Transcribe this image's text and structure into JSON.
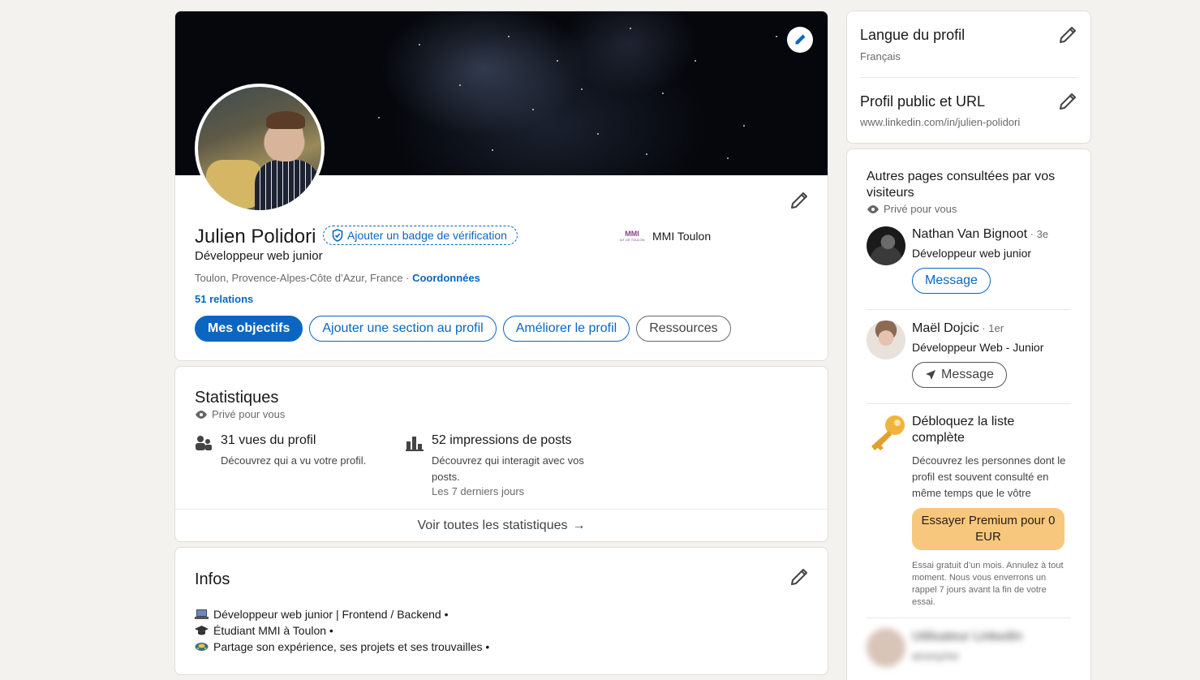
{
  "profile": {
    "name": "Julien Polidori",
    "verify_badge_label": "Ajouter un badge de vérification",
    "headline": "Développeur web junior",
    "location": "Toulon, Provence-Alpes-Côte d’Azur, France",
    "location_sep": " · ",
    "contact_link": "Coordonnées",
    "relations": "51 relations",
    "school_logo_text": "MMI",
    "school_logo_sub": "IUT DE TOULON",
    "school_name": "MMI Toulon",
    "buttons": {
      "goals": "Mes objectifs",
      "add_section": "Ajouter une section au profil",
      "improve": "Améliorer le profil",
      "resources": "Ressources"
    }
  },
  "stats": {
    "title": "Statistiques",
    "private": "Privé pour vous",
    "views_title": "31 vues du profil",
    "views_desc": "Découvrez qui a vu votre profil.",
    "impressions_title": "52 impressions de posts",
    "impressions_desc": "Découvrez qui interagit avec vos posts.",
    "impressions_period": "Les 7 derniers jours",
    "see_all": "Voir toutes les statistiques",
    "arrow": "→"
  },
  "infos": {
    "title": "Infos",
    "lines": [
      "Développeur web junior | Frontend / Backend •",
      "Étudiant MMI à Toulon •",
      "Partage son expérience, ses projets et ses trouvailles •"
    ]
  },
  "sidebar": {
    "language_title": "Langue du profil",
    "language_value": "Français",
    "public_title": "Profil public et URL",
    "public_url": "www.linkedin.com/in/julien-polidori",
    "visitors_title": "Autres pages consultées par vos visiteurs",
    "visitors_private": "Privé pour vous",
    "people": [
      {
        "name": "Nathan Van Bignoot",
        "degree": " · 3e",
        "headline": "Développeur web junior",
        "button": "Message"
      },
      {
        "name": "Maël Dojcic",
        "degree": " · 1er",
        "headline": "Développeur Web - Junior",
        "button": "Message"
      }
    ],
    "unlock_title": "Débloquez la liste complète",
    "unlock_desc": "Découvrez les personnes dont le profil est souvent consulté en même temps que le vôtre",
    "premium_button": "Essayer Premium pour 0 EUR",
    "premium_note": "Essai gratuit d’un mois. Annulez à tout moment. Nous vous enverrons un rappel 7 jours avant la fin de votre essai.",
    "blurred_name": "Utilisateur LinkedIn",
    "blurred_sub": "anonyme"
  },
  "colors": {
    "brand_blue": "#0a66c2",
    "premium_gold": "#f8c77e",
    "page_bg": "#f4f2ee"
  }
}
